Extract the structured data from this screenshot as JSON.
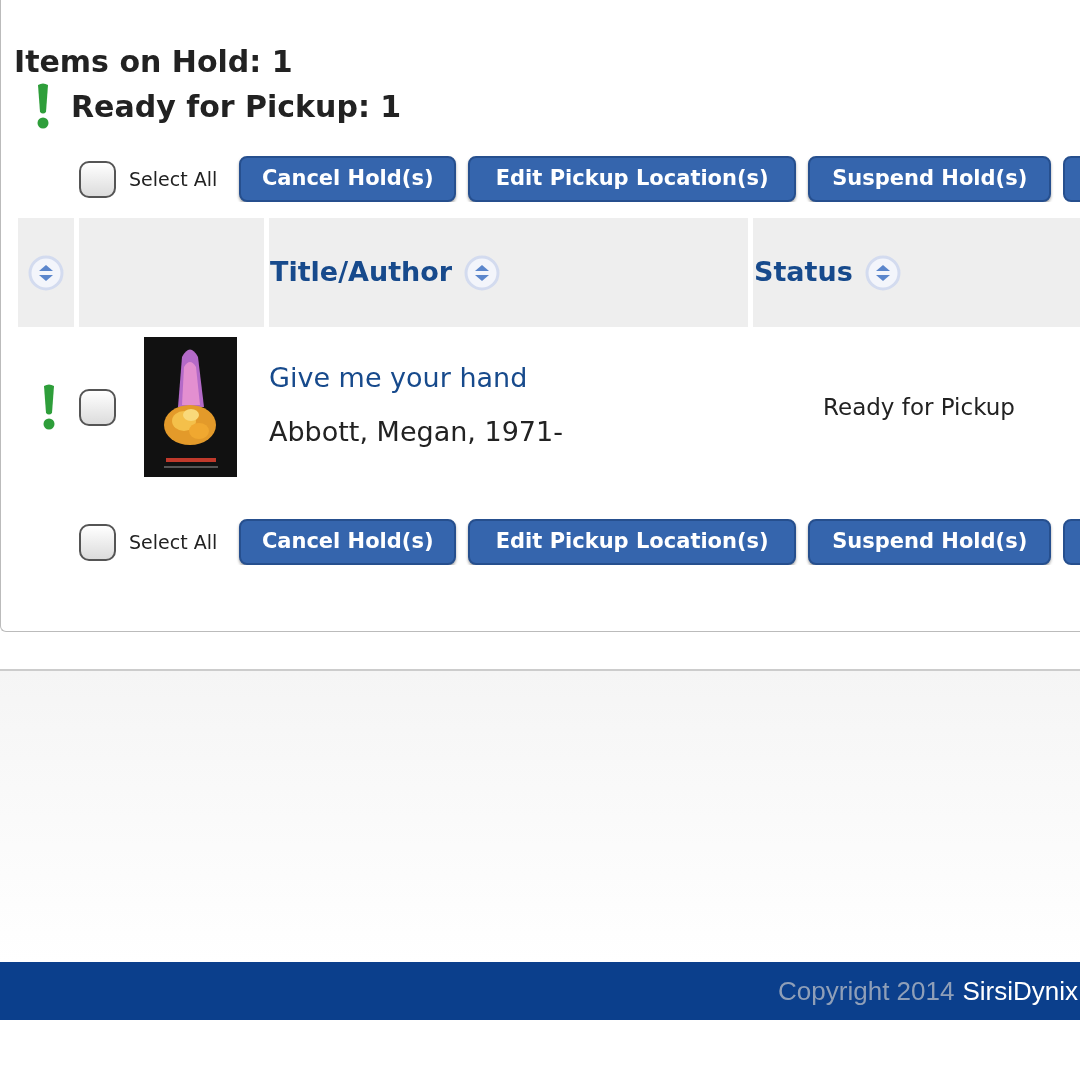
{
  "summary": {
    "items_on_hold": "Items on Hold: 1",
    "ready_for_pickup": "Ready for Pickup: 1",
    "ready_alert": true
  },
  "toolbars": [
    {
      "select_all": {
        "label": "Select All",
        "checked": false
      },
      "buttons": [
        "Cancel Hold(s)",
        "Edit Pickup Location(s)",
        "Suspend Hold(s)"
      ]
    },
    {
      "select_all": {
        "label": "Select All",
        "checked": false
      },
      "buttons": [
        "Cancel Hold(s)",
        "Edit Pickup Location(s)",
        "Suspend Hold(s)"
      ]
    }
  ],
  "table": {
    "columns": [
      {
        "kind": "sort"
      },
      {
        "kind": "empty"
      },
      {
        "kind": "label",
        "label": "Title/Author"
      },
      {
        "kind": "label",
        "label": "Status"
      }
    ],
    "rows": [
      {
        "ready_alert": true,
        "checked": false,
        "title": "Give me your hand",
        "author": "Abbott, Megan, 1971-",
        "status": "Ready for Pickup"
      }
    ]
  },
  "footer": {
    "copyright": "Copyright 2014",
    "link": "SirsiDynix"
  }
}
